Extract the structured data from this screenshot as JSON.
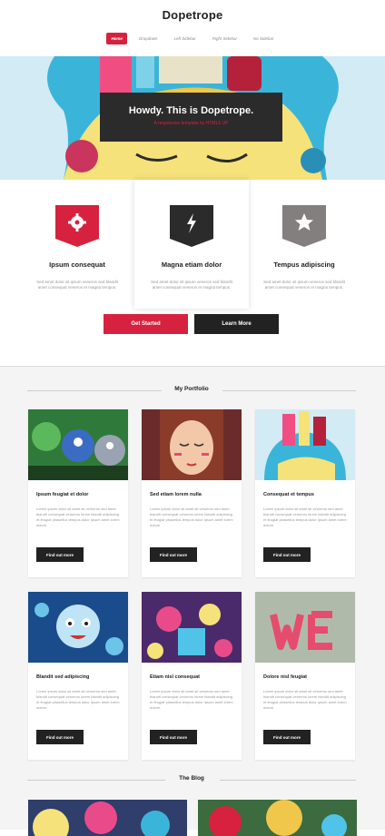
{
  "header": {
    "title": "Dopetrope",
    "nav": [
      "Home",
      "Dropdown",
      "Left Sidebar",
      "Right Sidebar",
      "No Sidebar"
    ]
  },
  "banner": {
    "title": "Howdy. This is Dopetrope.",
    "subtitle": "A responsive template by HTML5 UP"
  },
  "features": [
    {
      "title": "Ipsum consequat",
      "text": "Sed amet dolor sit ipsum veneros sed blandit amet consequat veneros et magna tempus.",
      "icon": "gear-icon",
      "color": "#d6223f"
    },
    {
      "title": "Magna etiam dolor",
      "text": "Sed amet dolor sit ipsum veneros sed blandit amet consequat veneros et magna tempus.",
      "icon": "bolt-icon",
      "color": "#2b2b2b"
    },
    {
      "title": "Tempus adipiscing",
      "text": "Sed amet dolor sit ipsum veneros sed blandit amet consequat veneros et magna tempus.",
      "icon": "star-icon",
      "color": "#837f7f"
    }
  ],
  "buttons": {
    "get_started": "Get Started",
    "learn_more": "Learn More"
  },
  "portfolio": {
    "heading": "My Portfolio",
    "card_text": "Lorem ipsum dolor sit amet sit veroeros sed amet blandit consequat veroeros lorem blandit adipiscing et feugiat phasellus tempus dolor ipsum amet lorem dolore.",
    "button_label": "Find out more",
    "items": [
      {
        "title": "Ipsum feugiat et dolor"
      },
      {
        "title": "Sed etiam lorem nulla"
      },
      {
        "title": "Consequat et tempus"
      },
      {
        "title": "Blandit sed adipiscing"
      },
      {
        "title": "Etiam nisl consequat"
      },
      {
        "title": "Dolore nisl feugiat"
      }
    ]
  },
  "blog": {
    "heading": "The Blog"
  },
  "colors": {
    "accent": "#d6223f",
    "dark": "#222222",
    "sky": "#d2ebf4"
  }
}
